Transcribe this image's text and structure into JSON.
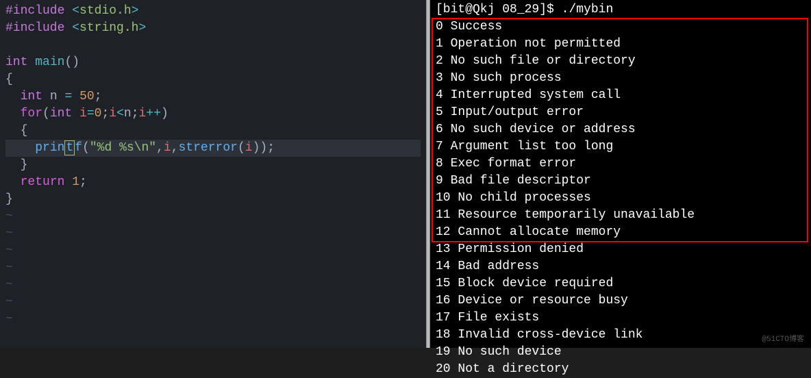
{
  "code": {
    "line1": {
      "directive": "#include",
      "open": "<",
      "header": "stdio.h",
      "close": ">"
    },
    "line2": {
      "directive": "#include",
      "open": "<",
      "header": "string.h",
      "close": ">"
    },
    "line3": "",
    "line4": {
      "type1": "int",
      "func": "main",
      "parens": "()"
    },
    "line5": {
      "brace": "{"
    },
    "line6": {
      "indent": "  ",
      "type": "int",
      "var": "n",
      "eq": "=",
      "val": "50",
      "semi": ";"
    },
    "line7": {
      "indent": "  ",
      "kw": "for",
      "open": "(",
      "type": "int",
      "var1": "i",
      "eq": "=",
      "val0": "0",
      "semi1": ";",
      "var2": "i",
      "lt": "<",
      "var3": "n",
      "semi2": ";",
      "var4": "i",
      "inc": "++",
      "close": ")"
    },
    "line8": {
      "indent": "  ",
      "brace": "{"
    },
    "line9": {
      "indent": "    ",
      "fn_pre": "prin",
      "fn_cursor": "t",
      "fn_post": "f",
      "open": "(",
      "str": "\"%d %s\\n\"",
      "comma1": ",",
      "arg1": "i",
      "comma2": ",",
      "fn2": "strerror",
      "open2": "(",
      "arg2": "i",
      "close2": ")",
      "close": ")",
      "semi": ";"
    },
    "line10": {
      "indent": "  ",
      "brace": "}"
    },
    "line11": {
      "indent": "  ",
      "kw": "return",
      "val": "1",
      "semi": ";"
    },
    "line12": {
      "brace": "}"
    }
  },
  "terminal": {
    "prompt": "[bit@Qkj 08_29]$ ",
    "command": "./mybin",
    "lines": [
      {
        "num": "0",
        "msg": "Success"
      },
      {
        "num": "1",
        "msg": "Operation not permitted"
      },
      {
        "num": "2",
        "msg": "No such file or directory"
      },
      {
        "num": "3",
        "msg": "No such process"
      },
      {
        "num": "4",
        "msg": "Interrupted system call"
      },
      {
        "num": "5",
        "msg": "Input/output error"
      },
      {
        "num": "6",
        "msg": "No such device or address"
      },
      {
        "num": "7",
        "msg": "Argument list too long"
      },
      {
        "num": "8",
        "msg": "Exec format error"
      },
      {
        "num": "9",
        "msg": "Bad file descriptor"
      },
      {
        "num": "10",
        "msg": "No child processes"
      },
      {
        "num": "11",
        "msg": "Resource temporarily unavailable"
      },
      {
        "num": "12",
        "msg": "Cannot allocate memory"
      },
      {
        "num": "13",
        "msg": "Permission denied"
      },
      {
        "num": "14",
        "msg": "Bad address"
      },
      {
        "num": "15",
        "msg": "Block device required"
      },
      {
        "num": "16",
        "msg": "Device or resource busy"
      },
      {
        "num": "17",
        "msg": "File exists"
      },
      {
        "num": "18",
        "msg": "Invalid cross-device link"
      },
      {
        "num": "19",
        "msg": "No such device"
      },
      {
        "num": "20",
        "msg": "Not a directory"
      }
    ]
  },
  "watermark": "@51CTO博客"
}
